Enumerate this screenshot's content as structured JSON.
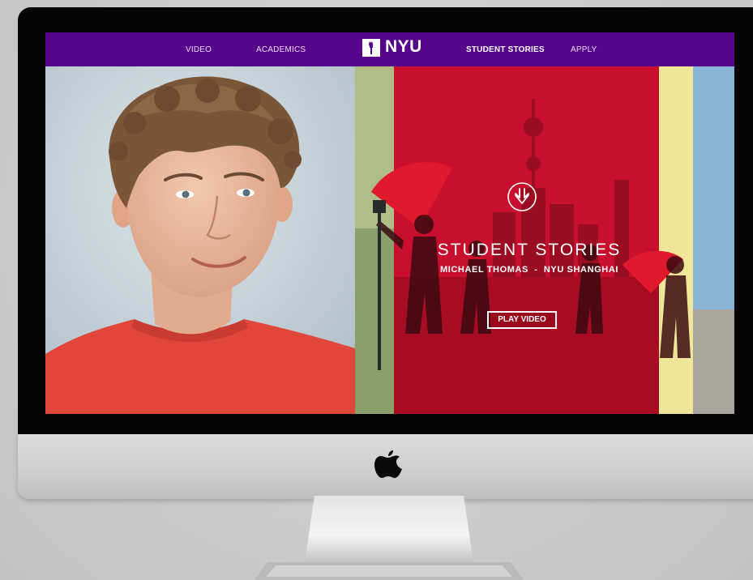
{
  "nav": {
    "video_label": "VIDEO",
    "academics_label": "ACADEMICS",
    "logo_text": "NYU",
    "student_stories_label": "STUDENT STORIES",
    "apply_label": "APPLY"
  },
  "hero": {
    "down_icon": "down-arrow-circle-icon",
    "section_title": "STUDENT STORIES",
    "subtitle": "MICHAEL THOMAS  -  NYU SHANGHAI",
    "play_label": "PLAY VIDEO"
  },
  "colors": {
    "nav_purple": "#57068c",
    "story_red": "#c8102e",
    "shirt_red": "#e2453a",
    "photo_bg": "#c9d5dd"
  }
}
